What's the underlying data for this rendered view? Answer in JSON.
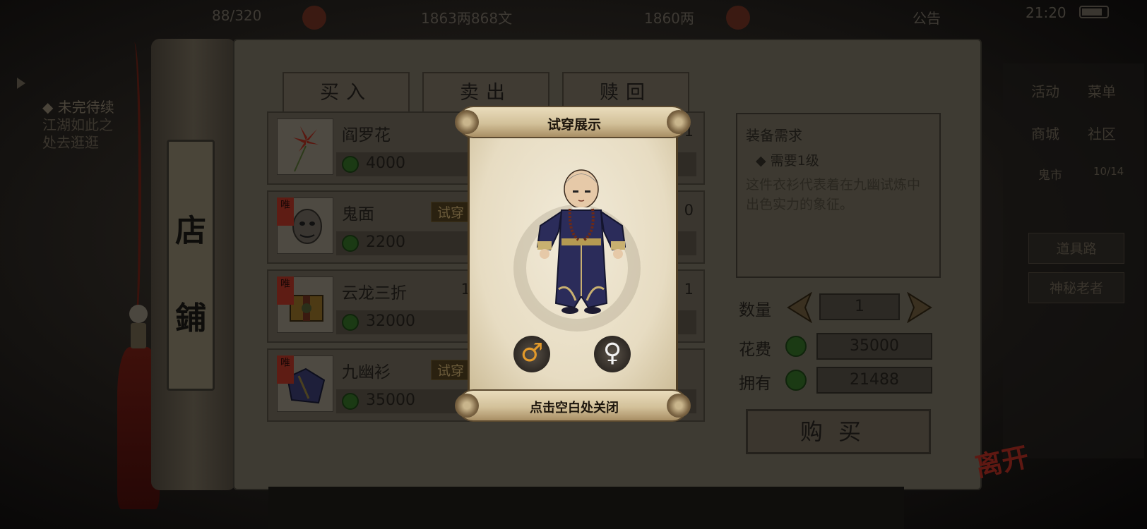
{
  "status_bar": {
    "stamina": "88/320",
    "copper": "1863两868文",
    "silver": "1860两",
    "announcement": "公告",
    "clock": "21:20"
  },
  "left_panel": {
    "quest_title": "◆ 未完待续",
    "quest_line1": "江湖如此之",
    "quest_line2": "处去逛逛"
  },
  "right_menu": {
    "row1": [
      "活动",
      "菜单"
    ],
    "row2": [
      "商城",
      "社区"
    ],
    "location": "鬼市",
    "location_count": "10/14",
    "btn_guide": "道具路",
    "btn_merchant": "神秘老者"
  },
  "shop": {
    "title_char1": "店",
    "title_char2": "鋪",
    "tabs": [
      "买入",
      "卖出",
      "赎回"
    ],
    "items": [
      {
        "name": "阎罗花",
        "price": "4000",
        "tail": "1",
        "try_label": ""
      },
      {
        "name": "鬼面",
        "price": "2200",
        "tail": "0",
        "try_label": "试穿",
        "ribbon": "唯"
      },
      {
        "name": "云龙三折",
        "price": "32000",
        "tail": "1",
        "try_label": "",
        "extra": "1",
        "ribbon": "唯"
      },
      {
        "name": "九幽衫",
        "price": "35000",
        "tail": "",
        "try_label": "试穿",
        "ribbon": "唯"
      }
    ],
    "info": {
      "heading": "装备需求",
      "requirement": "◆ 需要1级",
      "description": "这件衣衫代表着在九幽试炼中出色实力的象征。"
    },
    "quantity_label": "数量",
    "quantity_value": "1",
    "cost_label": "花费",
    "cost_value": "35000",
    "own_label": "拥有",
    "own_value": "21488",
    "buy_label": "购买",
    "leave_label": "离开"
  },
  "popup": {
    "title": "试穿展示",
    "close_hint": "点击空白处关闭",
    "male_symbol": "♂",
    "female_symbol": "♀"
  },
  "colors": {
    "coin_green": "#1b3a14",
    "parchment": "#ece3cc",
    "robe_navy": "#2b2c5a",
    "tassel_red": "#3e100b"
  }
}
